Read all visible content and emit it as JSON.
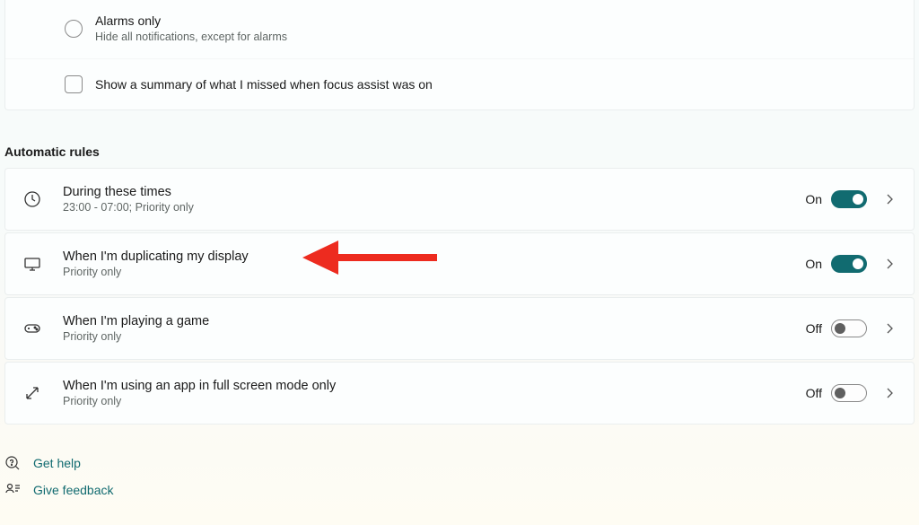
{
  "options": {
    "alarms_only": {
      "title": "Alarms only",
      "subtitle": "Hide all notifications, except for alarms"
    },
    "show_summary": {
      "label": "Show a summary of what I missed when focus assist was on"
    }
  },
  "section_heading": "Automatic rules",
  "rules": {
    "times": {
      "title": "During these times",
      "subtitle": "23:00 - 07:00; Priority only",
      "state_label": "On",
      "state": true
    },
    "duplicating": {
      "title": "When I'm duplicating my display",
      "subtitle": "Priority only",
      "state_label": "On",
      "state": true
    },
    "gaming": {
      "title": "When I'm playing a game",
      "subtitle": "Priority only",
      "state_label": "Off",
      "state": false
    },
    "fullscreen": {
      "title": "When I'm using an app in full screen mode only",
      "subtitle": "Priority only",
      "state_label": "Off",
      "state": false
    }
  },
  "footer": {
    "get_help": "Get help",
    "give_feedback": "Give feedback"
  },
  "colors": {
    "accent": "#116b70",
    "arrow": "#ed2b1f"
  }
}
